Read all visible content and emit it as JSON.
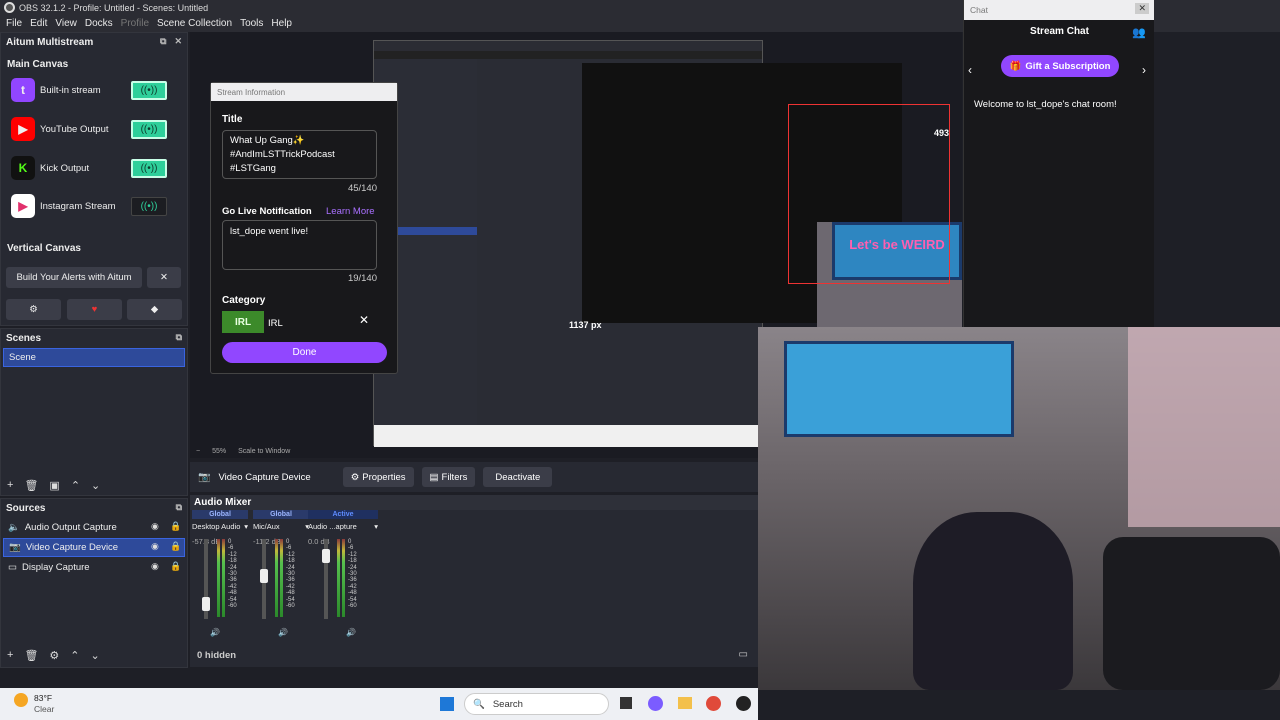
{
  "window": {
    "title": "OBS 32.1.2 - Profile: Untitled - Scenes: Untitled"
  },
  "menu": [
    "File",
    "Edit",
    "View",
    "Docks",
    "Profile",
    "Scene Collection",
    "Tools",
    "Help"
  ],
  "multistream": {
    "title": "Aitum Multistream",
    "main_canvas": "Main Canvas",
    "outputs": [
      {
        "label": "Built-in stream",
        "icon": "twitch-icon",
        "color": "#9146ff",
        "state": "on"
      },
      {
        "label": "YouTube Output",
        "icon": "youtube-icon",
        "color": "#ff0000",
        "state": "on"
      },
      {
        "label": "Kick Output",
        "icon": "kick-icon",
        "color": "#53fc18",
        "state": "on"
      },
      {
        "label": "Instagram Stream",
        "icon": "instagram-icon",
        "color": "#ffffff",
        "state": "off"
      }
    ],
    "vertical_canvas": "Vertical Canvas",
    "alerts_button": "Build Your Alerts with Aitum",
    "close_x": "✕"
  },
  "scenes": {
    "title": "Scenes",
    "items": [
      "Scene"
    ]
  },
  "sources": {
    "title": "Sources",
    "items": [
      "Audio Output Capture",
      "Video Capture Device",
      "Display Capture"
    ]
  },
  "popup": {
    "header": "Stream Information",
    "title_label": "Title",
    "title_lines": [
      "What Up Gang✨",
      "#AndImLSTTrickPodcast",
      "#LSTGang"
    ],
    "title_count": "45/140",
    "notif_label": "Go Live Notification",
    "learn_more": "Learn More",
    "notif_text": "lst_dope went live!",
    "notif_count": "19/140",
    "category_label": "Category",
    "category_name": "IRL",
    "category_thumb": "IRL",
    "done": "Done"
  },
  "preview": {
    "zoom": "55%",
    "scale": "Scale to Window",
    "px_label": "1137 px"
  },
  "source_bar": {
    "device": "Video Capture Device",
    "properties": "Properties",
    "filters": "Filters",
    "deactivate": "Deactivate"
  },
  "mixer": {
    "title": "Audio Mixer",
    "channels": [
      {
        "group": "Global",
        "name": "Desktop Audio",
        "db": "-57.3 dB",
        "level": 0.12
      },
      {
        "group": "Global",
        "name": "Mic/Aux",
        "db": "-11.2 dB",
        "level": 0.55
      },
      {
        "group": "Active",
        "name": "Audio ...apture",
        "db": "0.0 dB",
        "level": 0.85
      }
    ],
    "scale": [
      "0",
      "-6",
      "-12",
      "-18",
      "-24",
      "-30",
      "-36",
      "-42",
      "-48",
      "-54",
      "-60"
    ],
    "hidden": "0 hidden"
  },
  "chat": {
    "title": "Chat",
    "header": "Stream Chat",
    "gift": "Gift a Subscription",
    "welcome": "Welcome to lst_dope's chat room!"
  },
  "taskbar": {
    "temp": "83°F",
    "weather": "Clear",
    "search": "Search"
  },
  "inner": {
    "number": "493"
  }
}
